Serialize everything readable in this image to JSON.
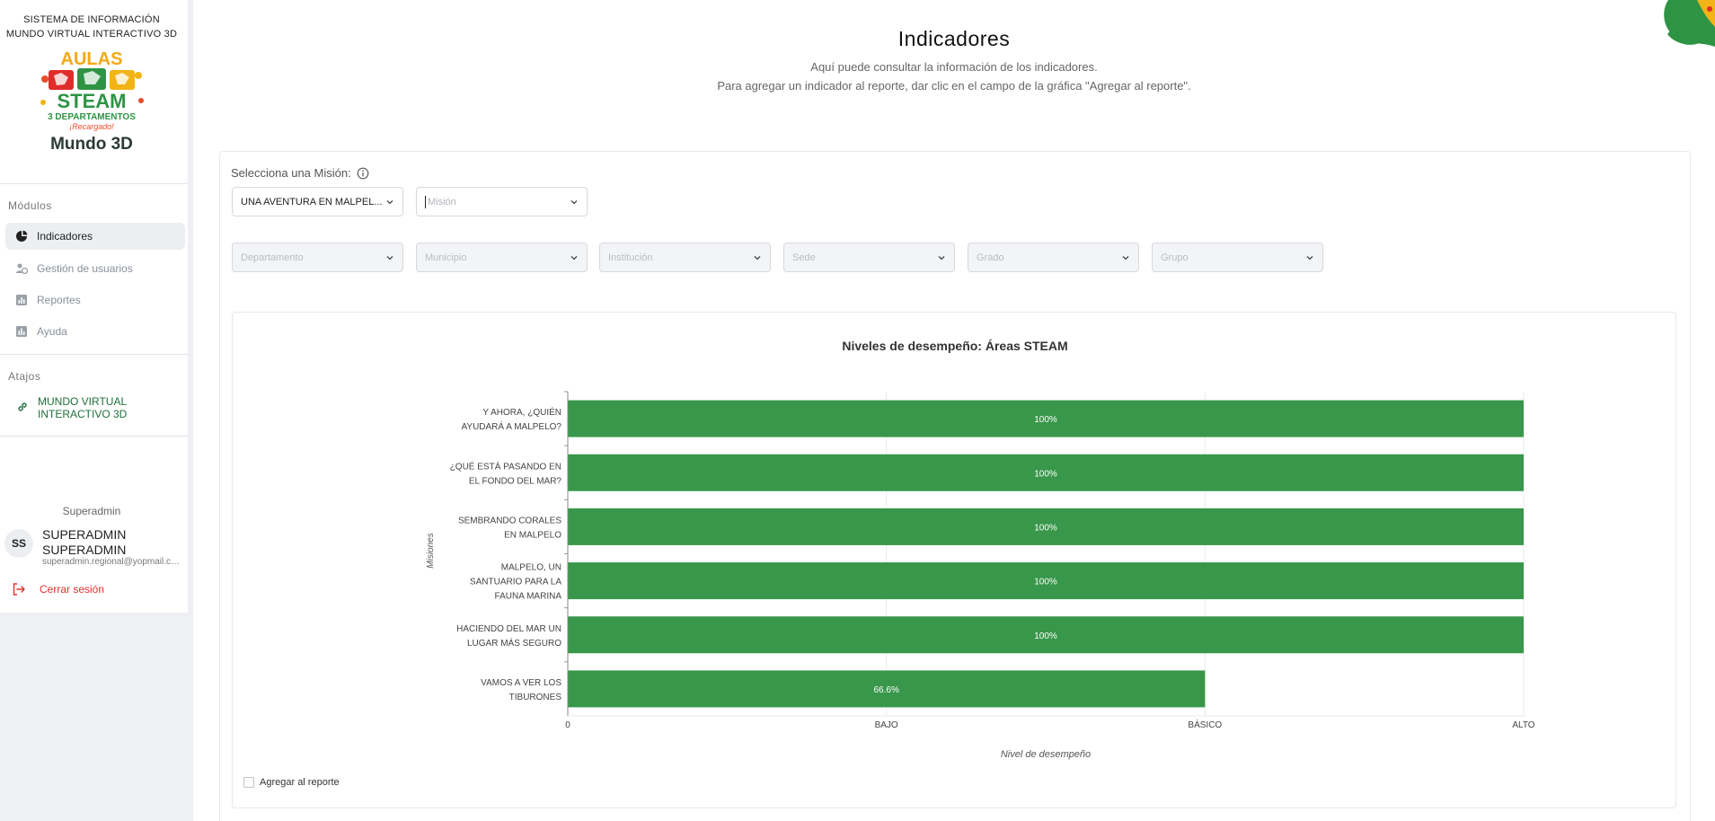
{
  "sidebar": {
    "system_title_line1": "SISTEMA DE INFORMACIÓN",
    "system_title_line2": "MUNDO VIRTUAL INTERACTIVO 3D",
    "logo": {
      "line1": "AULAS",
      "line2": "STEAM",
      "line3": "3 DEPARTAMENTOS",
      "line4": "¡Recargado!",
      "line5": "Mundo 3D"
    },
    "modules_title": "Módulos",
    "items": [
      {
        "label": "Indicadores",
        "icon": "pie-chart-icon"
      },
      {
        "label": "Gestión de usuarios",
        "icon": "users-icon"
      },
      {
        "label": "Reportes",
        "icon": "report-icon"
      },
      {
        "label": "Ayuda",
        "icon": "help-icon"
      }
    ],
    "shortcuts_title": "Atajos",
    "shortcut_label": "MUNDO VIRTUAL INTERACTIVO 3D",
    "role": "Superadmin",
    "avatar_initials": "SS",
    "user_name": "SUPERADMIN SUPERADMIN",
    "user_email": "superadmin.regional@yopmail.co...",
    "logout_label": "Cerrar sesión"
  },
  "header": {
    "title": "Indicadores",
    "subtitle_line1": "Aquí puede consultar la información de los indicadores.",
    "subtitle_line2": "Para agregar un indicador al reporte, dar clic en el campo de la gráfica \"Agregar al reporte\"."
  },
  "filters": {
    "mission_label": "Selecciona una Misión:",
    "adventure_value": "UNA AVENTURA EN MALPEL...",
    "mission_placeholder": "Misión",
    "department_placeholder": "Departamento",
    "municipality_placeholder": "Municipio",
    "institution_placeholder": "Institución",
    "site_placeholder": "Sede",
    "grade_placeholder": "Grado",
    "group_placeholder": "Grupo"
  },
  "colors": {
    "bar": "#38974a",
    "link": "#1f6f3b",
    "logout": "#e0312c"
  },
  "chart_data": {
    "type": "bar",
    "orientation": "horizontal",
    "title": "Niveles de desempeño: Áreas STEAM",
    "xlabel": "Nivel de desempeño",
    "ylabel": "Misiones",
    "categories": [
      [
        "Y AHORA, ¿QUIÉN",
        "AYUDARÁ A MALPELO?"
      ],
      [
        "¿QUÉ ESTÁ PASANDO EN",
        "EL FONDO DEL MAR?"
      ],
      [
        "SEMBRANDO CORALES",
        "EN MALPELO"
      ],
      [
        "MALPELO, UN",
        "SANTUARIO PARA LA",
        "FAUNA MARINA"
      ],
      [
        "HACIENDO DEL MAR UN",
        "LUGAR MÁS SEGURO"
      ],
      [
        "VAMOS A VER LOS",
        "TIBURONES"
      ]
    ],
    "values": [
      3,
      3,
      3,
      3,
      3,
      2
    ],
    "data_labels": [
      "100%",
      "100%",
      "100%",
      "100%",
      "100%",
      "66.6%"
    ],
    "x_ticks": [
      "0",
      "BAJO",
      "BÁSICO",
      "ALTO"
    ],
    "xlim": [
      0,
      3
    ],
    "grid": true,
    "legend": "none"
  },
  "add_to_report_label": "Agregar al reporte"
}
